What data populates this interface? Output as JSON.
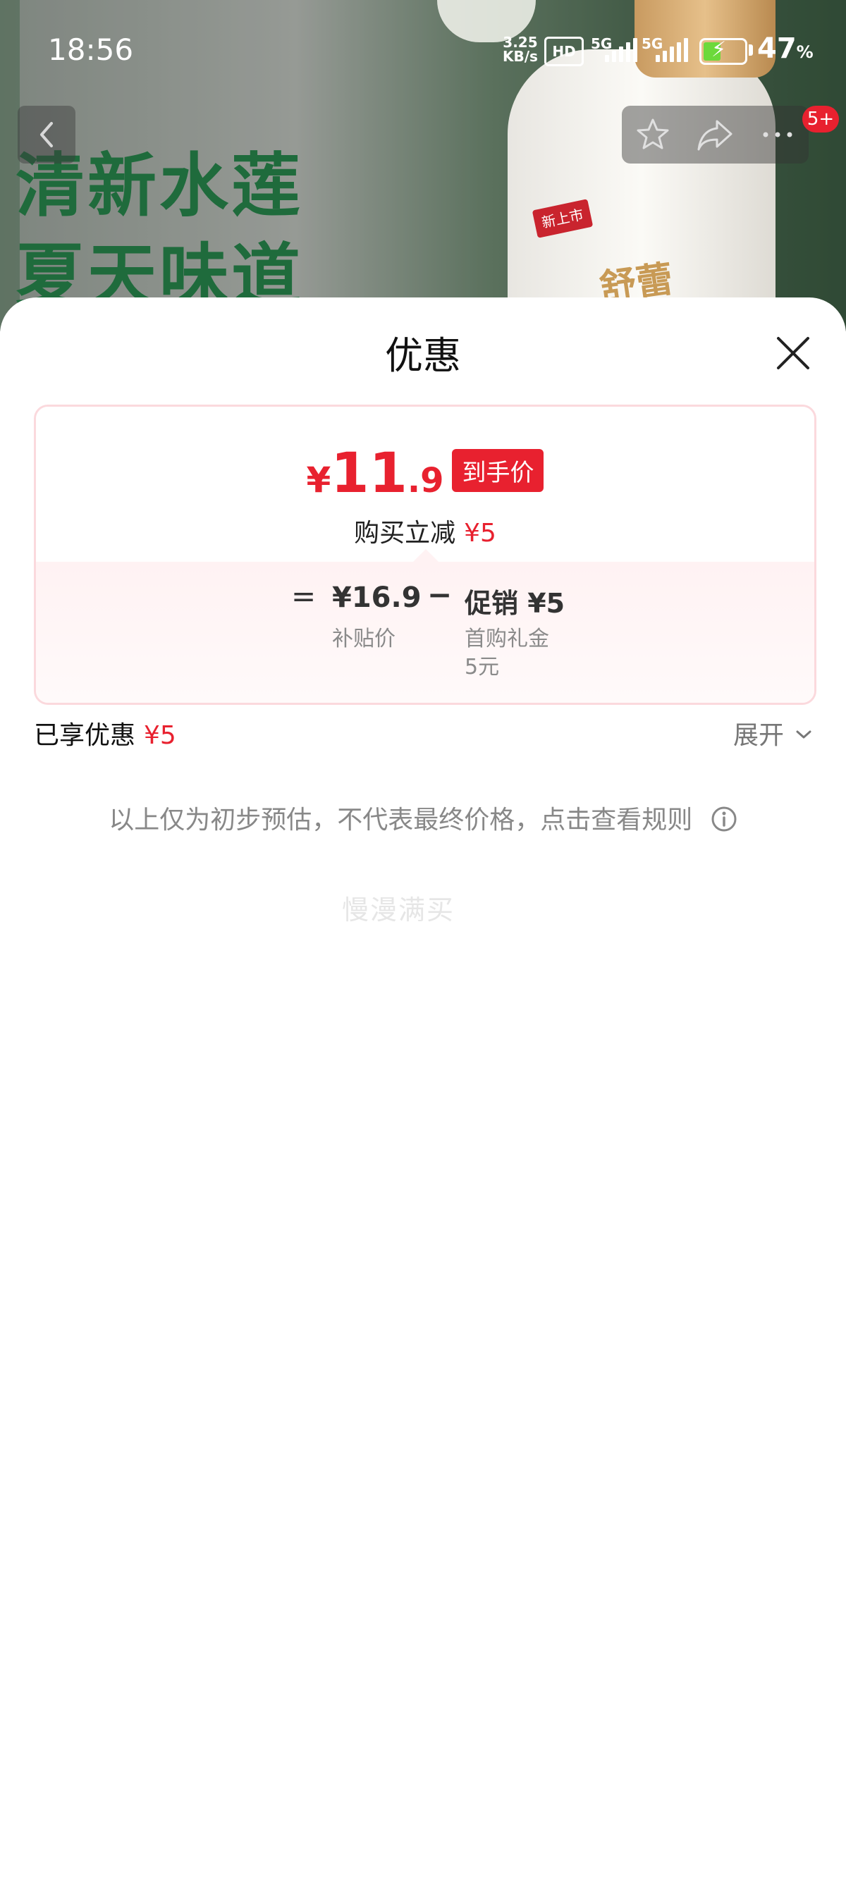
{
  "status_bar": {
    "time": "18:56",
    "net_speed_value": "3.25",
    "net_speed_unit": "KB/s",
    "hd_label": "HD",
    "network_1": "5G",
    "network_2": "5G",
    "battery_percent": "47",
    "battery_unit": "%"
  },
  "hero": {
    "slogan_line1": "清新水莲",
    "slogan_line2": "夏天味道",
    "new_badge": "新上市",
    "brand": "舒蕾"
  },
  "nav": {
    "notification_badge": "5+"
  },
  "sheet": {
    "title": "优惠",
    "final_price": {
      "symbol": "¥",
      "integer": "11",
      "decimal": ".9",
      "tag": "到手价"
    },
    "save_label": "购买立减",
    "save_amount": "¥5",
    "breakdown": {
      "equals": "=",
      "subsidy_price": "¥16.9",
      "subsidy_label": "补贴价",
      "minus": "−",
      "promo_title": "促销 ¥5",
      "promo_label": "首购礼金",
      "promo_amount": "5元"
    },
    "enjoyed_label": "已享优惠",
    "enjoyed_amount": "¥5",
    "expand_label": "展开",
    "disclaimer": "以上仅为初步预估，不代表最终价格，点击查看规则",
    "watermark": "慢漫满买"
  },
  "colors": {
    "accent_red": "#e8212f",
    "card_border": "#fbd9dd",
    "battery_green": "#6cd93b"
  }
}
